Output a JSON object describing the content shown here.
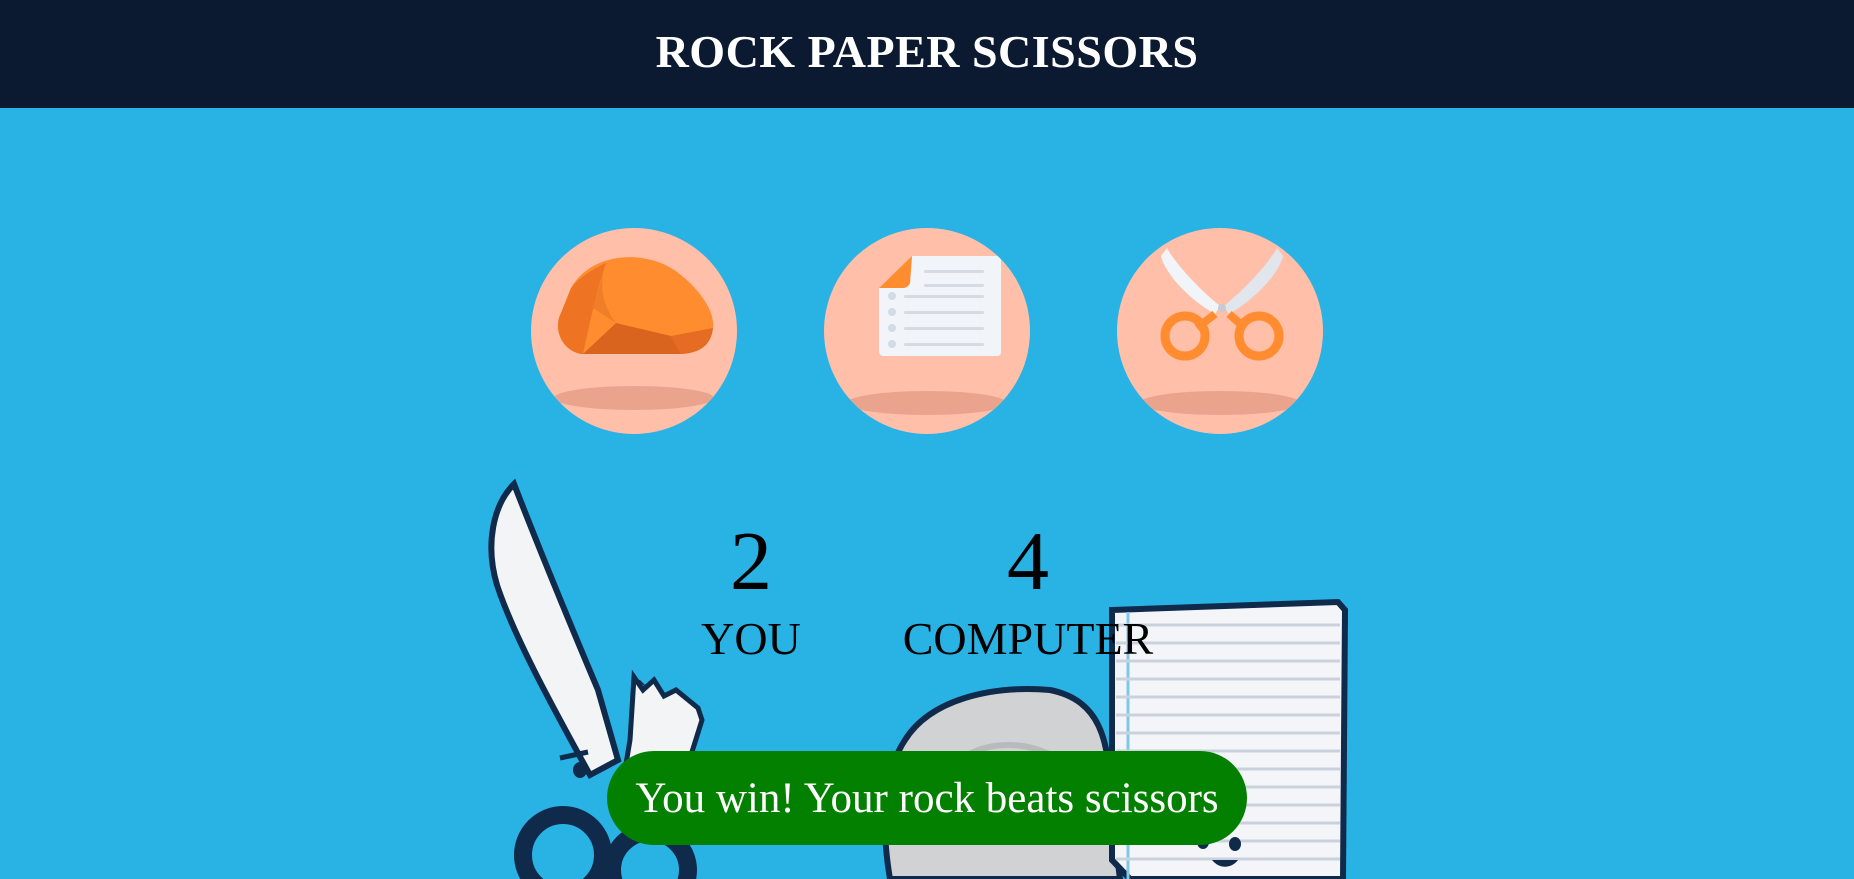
{
  "header": {
    "title": "ROCK PAPER SCISSORS"
  },
  "choices": [
    {
      "id": "rock",
      "icon": "rock-icon"
    },
    {
      "id": "paper",
      "icon": "paper-icon"
    },
    {
      "id": "scissors",
      "icon": "scissors-icon"
    }
  ],
  "scoreboard": {
    "player": {
      "score": "2",
      "label": "YOU"
    },
    "computer": {
      "score": "4",
      "label": "COMPUTER"
    }
  },
  "result": {
    "message": "You win! Your rock beats scissors"
  },
  "colors": {
    "header_bg": "#0b1a30",
    "page_bg": "#29b2e4",
    "choice_circle": "#ffbfa8",
    "accent_orange": "#ff8c2e",
    "result_bg": "#048000"
  }
}
